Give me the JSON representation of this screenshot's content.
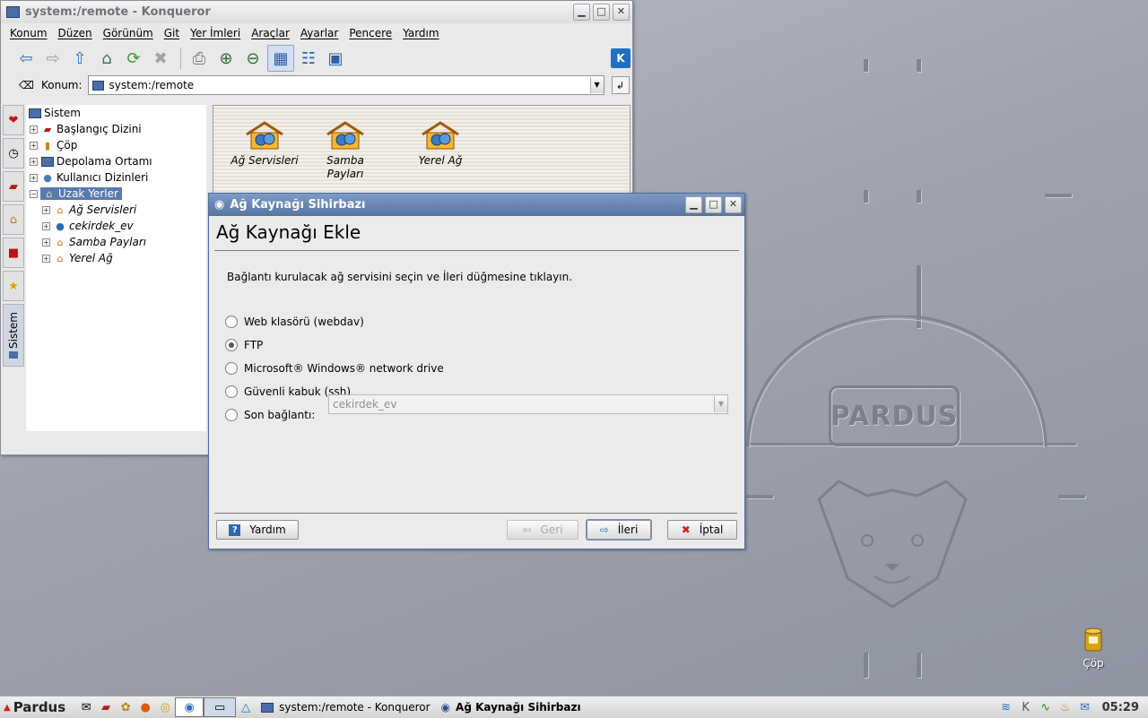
{
  "konqueror": {
    "title": "system:/remote - Konqueror",
    "menu": [
      "Konum",
      "Düzen",
      "Görünüm",
      "Git",
      "Yer İmleri",
      "Araçlar",
      "Ayarlar",
      "Pencere",
      "Yardım"
    ],
    "location_label": "Konum:",
    "location_value": "system:/remote",
    "sidebar_tab_label": "Sistem",
    "tree": {
      "root": "Sistem",
      "items": [
        "Başlangıç Dizini",
        "Çöp",
        "Depolama Ortamı",
        "Kullanıcı Dizinleri",
        "Uzak Yerler"
      ],
      "children": [
        "Ağ Servisleri",
        "cekirdek_ev",
        "Samba Payları",
        "Yerel Ağ"
      ]
    },
    "files": [
      "Ağ Servisleri",
      "Samba Payları",
      "Yerel Ağ"
    ]
  },
  "dialog": {
    "title": "Ağ Kaynağı Sihirbazı",
    "heading": "Ağ Kaynağı Ekle",
    "intro": "Bağlantı kurulacak ağ servisini seçin ve İleri düğmesine tıklayın.",
    "options": {
      "webdav": "Web klasörü (webdav)",
      "ftp": "FTP",
      "windows": "Microsoft® Windows® network drive",
      "ssh": "Güvenli kabuk (ssh)",
      "recent": "Son bağlantı:"
    },
    "selected_option": "FTP",
    "recent_value": "cekirdek_ev",
    "buttons": {
      "help": "Yardım",
      "back": "Geri",
      "next": "İleri",
      "cancel": "İptal"
    }
  },
  "desktop": {
    "trash_label": "Çöp",
    "logo_text": "PARDUS"
  },
  "taskbar": {
    "start_label": "Pardus",
    "tasks": [
      "system:/remote - Konqueror",
      "Ağ Kaynağı Sihirbazı"
    ],
    "clock": "05:29"
  },
  "colors": {
    "accent": "#5a7aae",
    "dialog_title": "#56759f",
    "kde_blue": "#1f6fc4"
  }
}
